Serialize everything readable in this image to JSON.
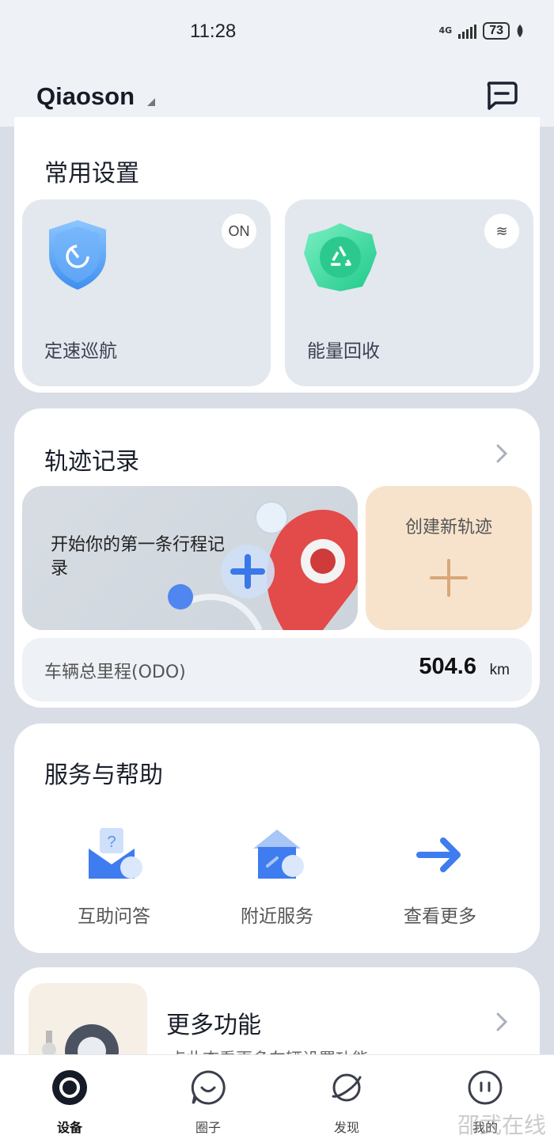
{
  "status_bar": {
    "time": "11:28",
    "network": "4G",
    "battery": "73"
  },
  "header": {
    "account_name": "Qiaoson",
    "message_icon": "message-square-icon"
  },
  "common_settings": {
    "title": "常用设置",
    "tiles": [
      {
        "label": "定速巡航",
        "badge": "ON",
        "icon": "shield-speedometer-icon"
      },
      {
        "label": "能量回收",
        "badge": "≋",
        "icon": "recycle-hexagon-icon"
      }
    ]
  },
  "track_records": {
    "title": "轨迹记录",
    "banner_text": "开始你的第一条行程记录",
    "new_track_label": "创建新轨迹",
    "odo_label": "车辆总里程(ODO)",
    "odo_value": "504.6",
    "odo_unit": "km"
  },
  "service_help": {
    "title": "服务与帮助",
    "items": [
      {
        "label": "互助问答",
        "icon": "qa-mail-icon"
      },
      {
        "label": "附近服务",
        "icon": "house-service-icon"
      },
      {
        "label": "查看更多",
        "icon": "arrow-right-icon"
      }
    ]
  },
  "more_features": {
    "title": "更多功能",
    "subtitle": "点此查看更多车辆设置功能"
  },
  "bottom_nav": {
    "items": [
      {
        "label": "设备",
        "icon": "device-ring-icon",
        "active": true
      },
      {
        "label": "圈子",
        "icon": "smile-bubble-icon"
      },
      {
        "label": "发现",
        "icon": "planet-icon"
      },
      {
        "label": "我的",
        "icon": "face-icon"
      }
    ]
  },
  "watermark": "邵武在线",
  "colors": {
    "accent_blue": "#3f7cf0",
    "teal": "#2fd19a",
    "orange_plus": "#d9a77a",
    "dark": "#1c2230"
  }
}
